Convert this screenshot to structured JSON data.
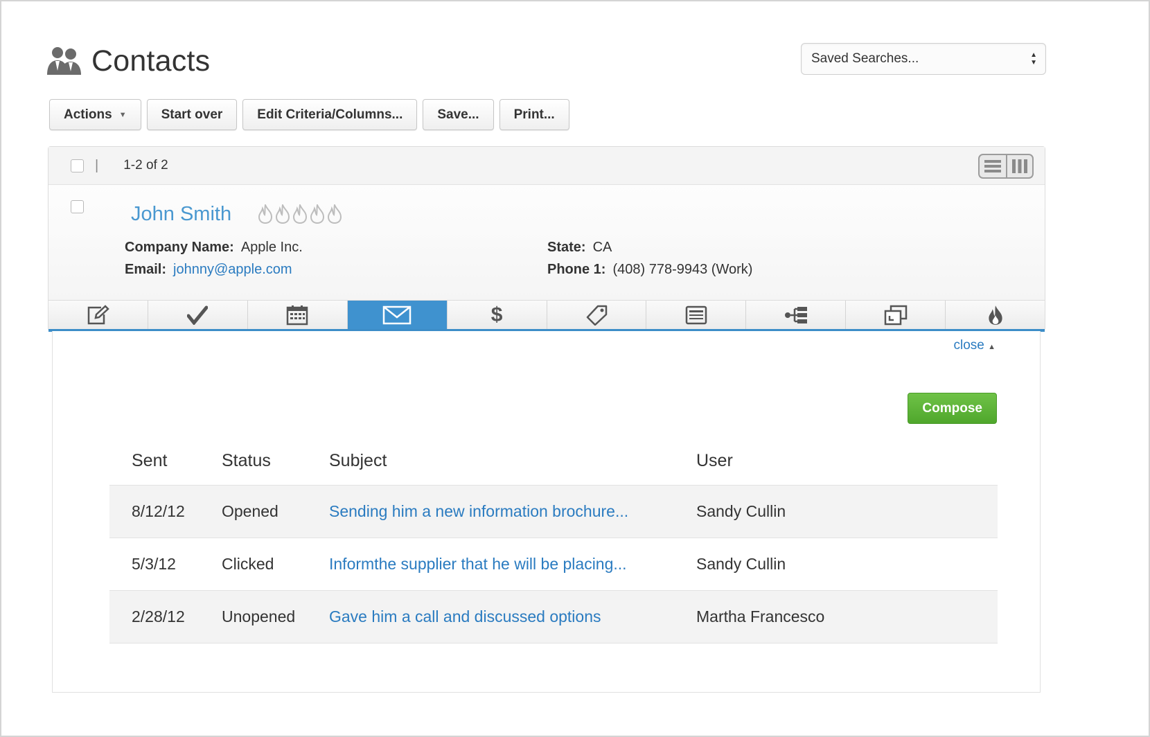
{
  "header": {
    "title": "Contacts",
    "icon": "contacts-icon"
  },
  "saved_searches": {
    "label": "Saved Searches..."
  },
  "toolbar": {
    "actions": "Actions",
    "start_over": "Start over",
    "edit_criteria": "Edit Criteria/Columns...",
    "save": "Save...",
    "print": "Print..."
  },
  "list": {
    "range": "1-2 of 2",
    "contact": {
      "name": "John Smith",
      "rating_total": 5,
      "company_label": "Company Name:",
      "company": "Apple Inc.",
      "email_label": "Email:",
      "email": "johnny@apple.com",
      "state_label": "State:",
      "state": "CA",
      "phone_label": "Phone 1:",
      "phone": "(408) 778-9943 (Work)"
    },
    "tabs": [
      {
        "icon": "edit-note-icon"
      },
      {
        "icon": "checkmark-icon"
      },
      {
        "icon": "calendar-icon"
      },
      {
        "icon": "email-icon",
        "active": true
      },
      {
        "icon": "dollar-icon"
      },
      {
        "icon": "tag-icon"
      },
      {
        "icon": "document-icon"
      },
      {
        "icon": "hierarchy-icon"
      },
      {
        "icon": "duplicate-icon"
      },
      {
        "icon": "flame-icon"
      }
    ]
  },
  "detail": {
    "close_label": "close",
    "compose_label": "Compose",
    "columns": [
      "Sent",
      "Status",
      "Subject",
      "User"
    ],
    "rows": [
      {
        "sent": "8/12/12",
        "status": "Opened",
        "subject": "Sending him a new information brochure...",
        "user": "Sandy Cullin"
      },
      {
        "sent": "5/3/12",
        "status": "Clicked",
        "subject": "Informthe supplier that he will be placing...",
        "user": "Sandy Cullin"
      },
      {
        "sent": "2/28/12",
        "status": "Unopened",
        "subject": "Gave him a call and discussed options",
        "user": "Martha Francesco"
      }
    ]
  },
  "colors": {
    "accent": "#3f92cf",
    "link": "#2a7bc0",
    "compose": "#5cb536"
  }
}
